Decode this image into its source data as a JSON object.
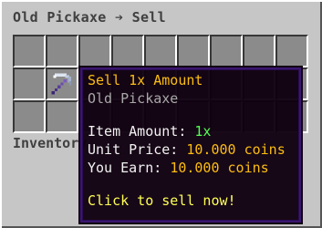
{
  "window": {
    "title": "Old Pickaxe ➔ Sell",
    "inventory_label": "Inventory"
  },
  "item": {
    "icon": "pickaxe-icon",
    "name": "Old Pickaxe"
  },
  "tooltip": {
    "heading": "Sell 1x Amount",
    "item_name": "Old Pickaxe",
    "amount_label": "Item Amount:",
    "amount_value": "1x",
    "unit_price_label": "Unit Price:",
    "unit_price_value": "10.000 coins",
    "you_earn_label": "You Earn:",
    "you_earn_value": "10.000 coins",
    "action": "Click to sell now!"
  },
  "colors": {
    "gold": "#fcbd12",
    "green": "#55ff55",
    "yellow": "#ffff55",
    "gray": "#a8a8a8"
  }
}
